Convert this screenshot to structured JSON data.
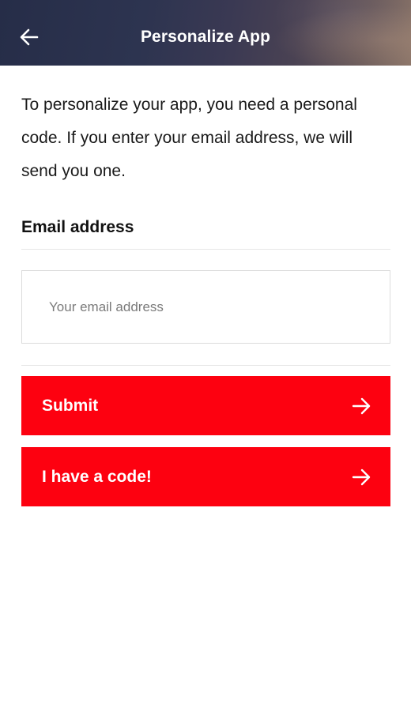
{
  "header": {
    "title": "Personalize App",
    "back_icon": "arrow-left-icon"
  },
  "intro": {
    "text": "To personalize your app, you need a personal code. If you enter your email address, we will send you one."
  },
  "email": {
    "label": "Email address",
    "placeholder": "Your email address",
    "value": ""
  },
  "buttons": {
    "submit_label": "Submit",
    "code_label": "I have a code!",
    "arrow_icon": "arrow-right-icon"
  },
  "colors": {
    "primary_red": "#fd0110",
    "header_bg": "#2d3450"
  }
}
